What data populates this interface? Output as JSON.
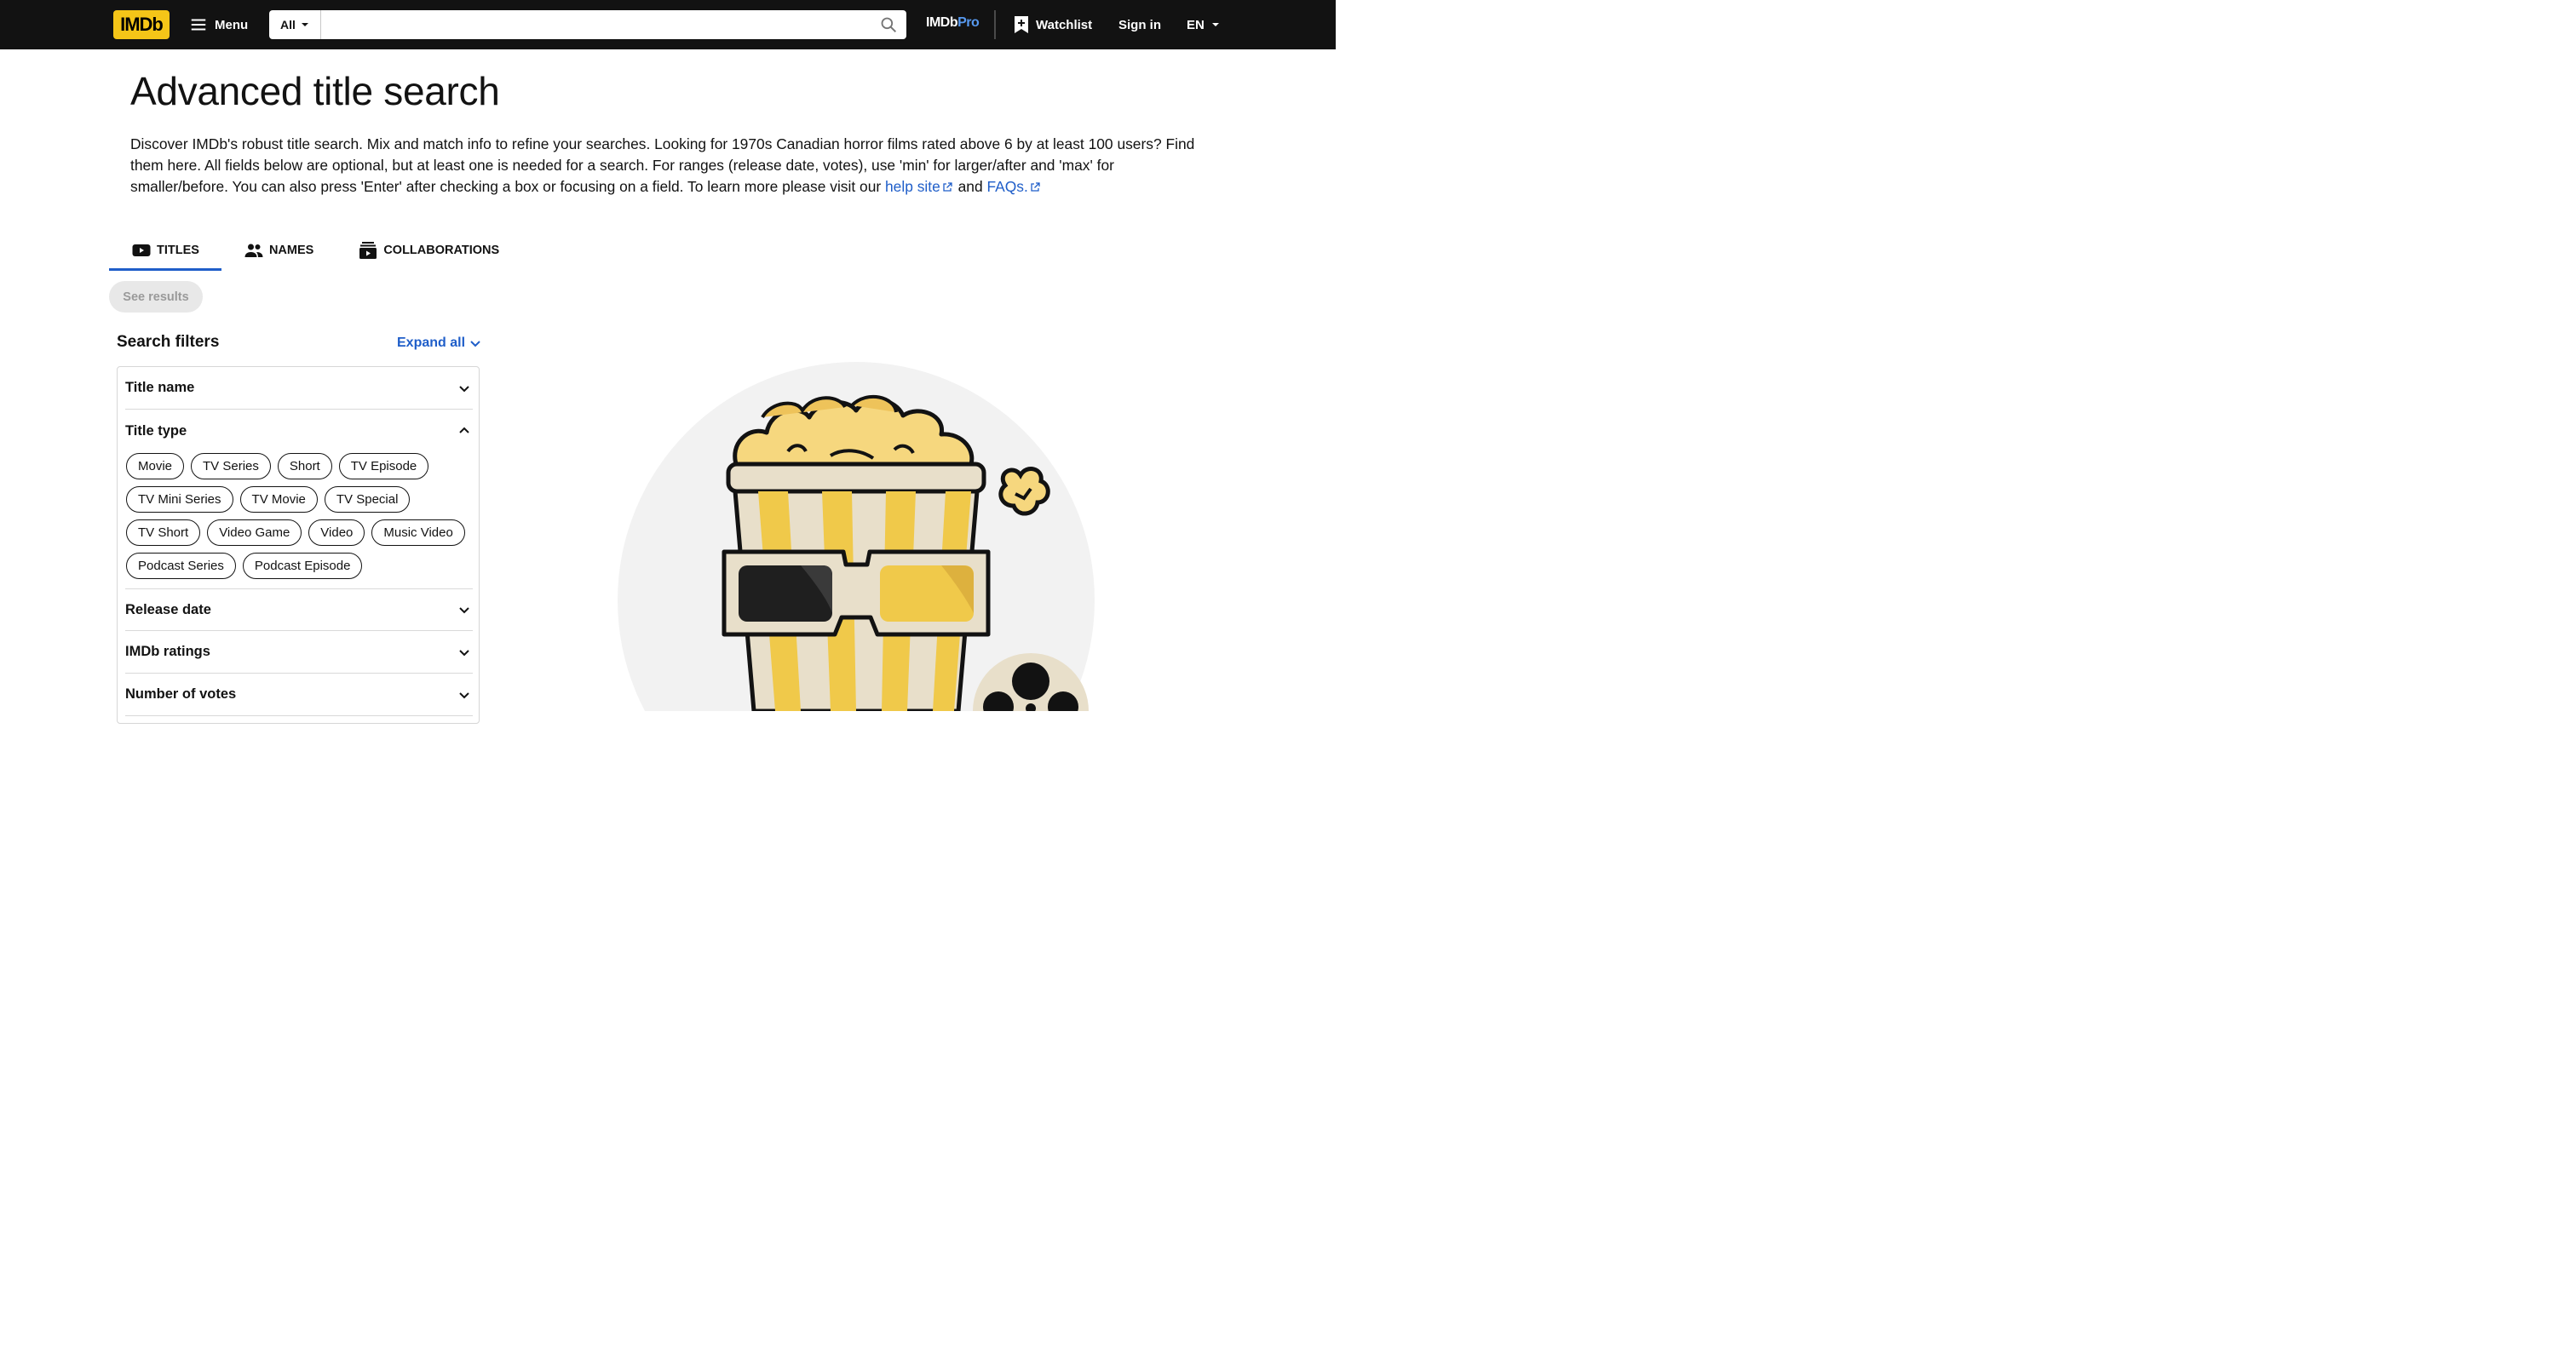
{
  "nav": {
    "logo_text": "IMDb",
    "menu_label": "Menu",
    "search_category": "All",
    "search_placeholder": "",
    "imdbpro_main": "IMDb",
    "imdbpro_suffix": "Pro",
    "watchlist_label": "Watchlist",
    "signin_label": "Sign in",
    "language": "EN"
  },
  "page": {
    "title": "Advanced title search",
    "intro_text": "Discover IMDb's robust title search. Mix and match info to refine your searches. Looking for 1970s Canadian horror films rated above 6 by at least 100 users? Find them here. All fields below are optional, but at least one is needed for a search. For ranges (release date, votes), use 'min' for larger/after and 'max' for smaller/before. You can also press 'Enter' after checking a box or focusing on a field. To learn more please visit our",
    "help_link": "help site",
    "and_text": "and",
    "faq_link": "FAQs."
  },
  "tabs": [
    {
      "label": "TITLES",
      "icon": "video-icon",
      "active": true
    },
    {
      "label": "NAMES",
      "icon": "people-icon",
      "active": false
    },
    {
      "label": "COLLABORATIONS",
      "icon": "collaborations-icon",
      "active": false
    }
  ],
  "see_results_label": "See results",
  "filters": {
    "title": "Search filters",
    "expand_all": "Expand all",
    "sections": [
      {
        "label": "Title name",
        "expanded": false
      },
      {
        "label": "Title type",
        "expanded": true
      },
      {
        "label": "Release date",
        "expanded": false
      },
      {
        "label": "IMDb ratings",
        "expanded": false
      },
      {
        "label": "Number of votes",
        "expanded": false
      }
    ],
    "title_types": [
      [
        "Movie",
        "TV Series",
        "Short",
        "TV Episode"
      ],
      [
        "TV Mini Series",
        "TV Movie",
        "TV Special"
      ],
      [
        "TV Short",
        "Video Game",
        "Video",
        "Music Video"
      ],
      [
        "Podcast Series",
        "Podcast Episode"
      ]
    ]
  },
  "colors": {
    "accent_blue": "#1f5ec9",
    "imdb_yellow": "#f5c518",
    "nav_bg": "#121212"
  }
}
